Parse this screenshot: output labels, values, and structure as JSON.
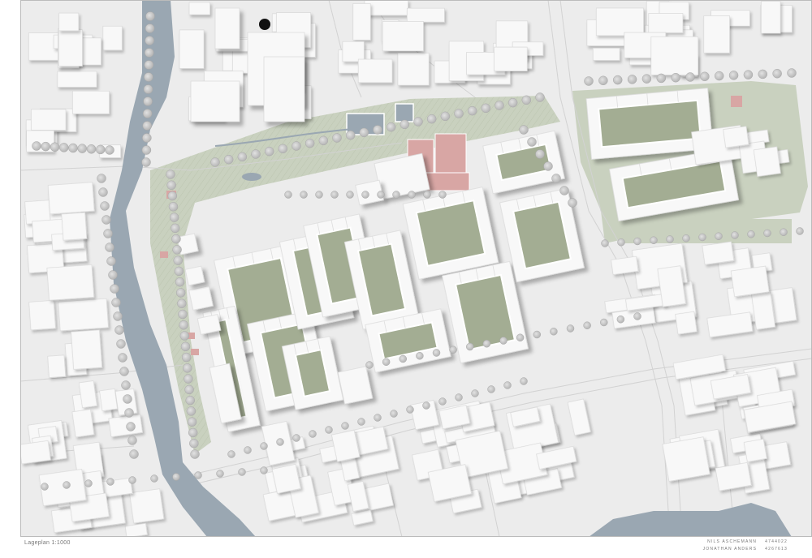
{
  "sheet": {
    "scale_label": "Lageplan  1:1000",
    "authors": [
      {
        "name": "NILS ASCHEMANN",
        "id": "4744022"
      },
      {
        "name": "JONATHAN ANDERS",
        "id": "4267613"
      }
    ]
  },
  "map_elements": {
    "river": "river",
    "park_strip": "park-strip",
    "district_blocks": "district-blocks",
    "trees": "trees",
    "roads": "roads",
    "sports_courts": "sports-courts",
    "pools": "pools"
  },
  "colors": {
    "water": "#9aa7b2",
    "park": "#c9d1bf",
    "courtyard": "#a3ad93",
    "plaza_red": "#d8a6a4",
    "building": "#f8f8f8",
    "shadow": "#bdbdbd",
    "road_line": "#cfcfcf",
    "tree": "#c6c6c6"
  }
}
